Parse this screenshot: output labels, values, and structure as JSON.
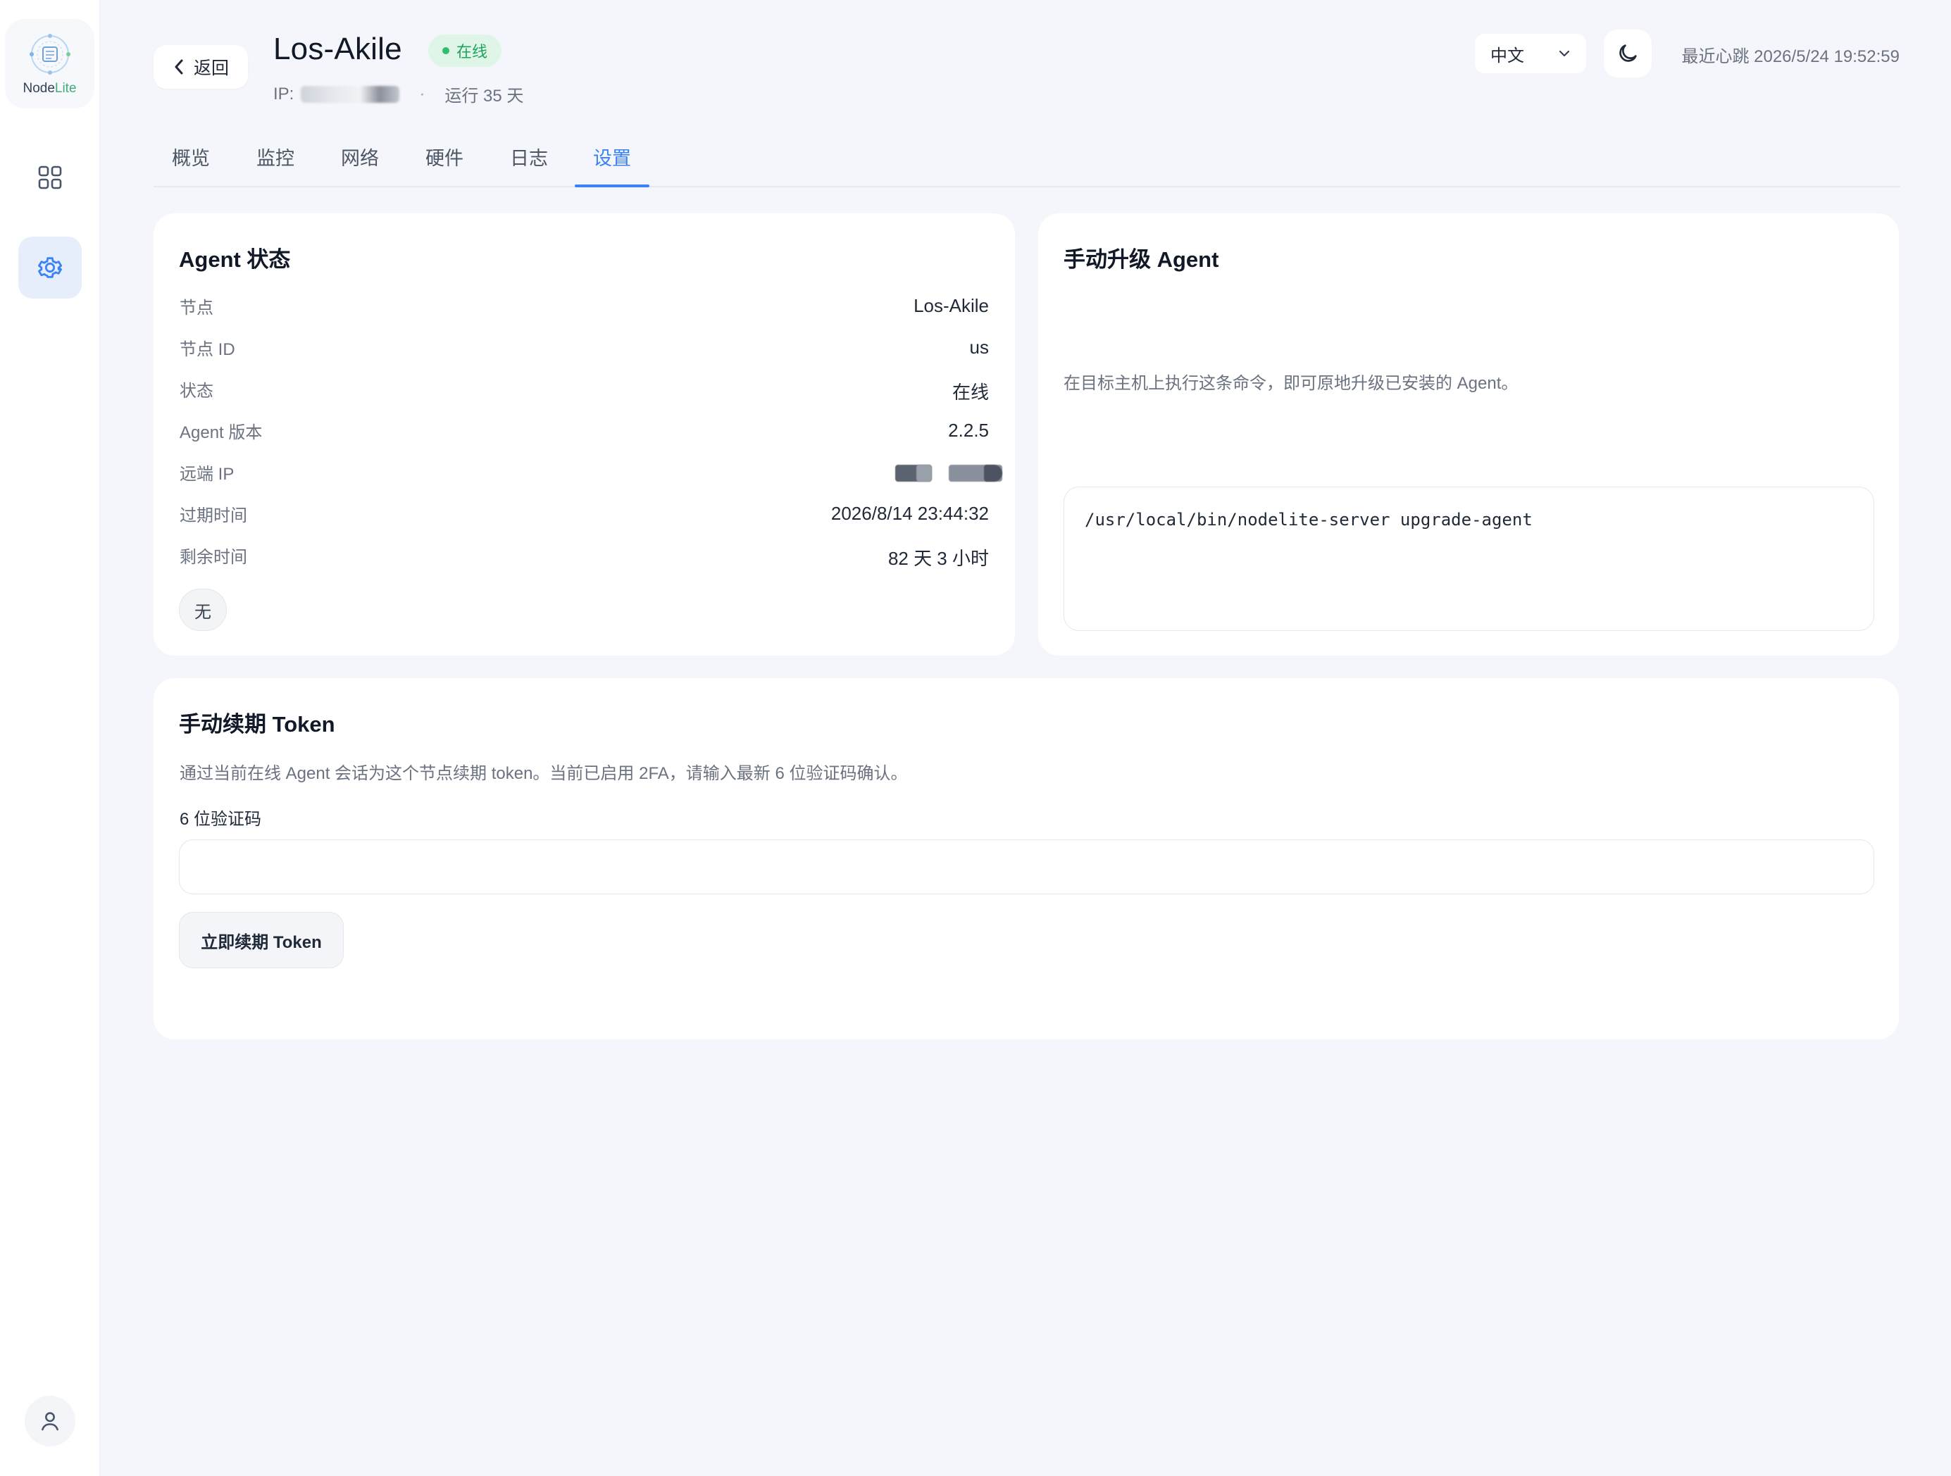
{
  "app": {
    "logo_text_a": "Node",
    "logo_text_b": "Lite"
  },
  "header": {
    "back_label": "返回",
    "node_name": "Los-Akile",
    "status": "在线",
    "ip_prefix": "IP:",
    "uptime": "运行 35 天",
    "language": "中文",
    "heartbeat": "最近心跳 2026/5/24 19:52:59"
  },
  "tabs": [
    {
      "label": "概览"
    },
    {
      "label": "监控"
    },
    {
      "label": "网络"
    },
    {
      "label": "硬件"
    },
    {
      "label": "日志"
    },
    {
      "label": "设置"
    }
  ],
  "agent_status": {
    "title": "Agent 状态",
    "rows": [
      {
        "label": "节点",
        "value": "Los-Akile"
      },
      {
        "label": "节点 ID",
        "value": "us"
      },
      {
        "label": "状态",
        "value": "在线"
      },
      {
        "label": "Agent 版本",
        "value": "2.2.5"
      },
      {
        "label": "远端 IP",
        "value": ""
      },
      {
        "label": "过期时间",
        "value": "2026/8/14 23:44:32"
      },
      {
        "label": "剩余时间",
        "value": "82 天 3 小时"
      }
    ],
    "chip": "无"
  },
  "upgrade": {
    "title": "手动升级 Agent",
    "description": "在目标主机上执行这条命令，即可原地升级已安装的 Agent。",
    "command": "/usr/local/bin/nodelite-server upgrade-agent"
  },
  "renew": {
    "title": "手动续期 Token",
    "description": "通过当前在线 Agent 会话为这个节点续期 token。当前已启用 2FA，请输入最新 6 位验证码确认。",
    "field_label": "6 位验证码",
    "field_value": "",
    "button_label": "立即续期 Token"
  },
  "colors": {
    "accent": "#3b82f6",
    "online": "#21a35c",
    "online_bg": "#dff5e8"
  }
}
